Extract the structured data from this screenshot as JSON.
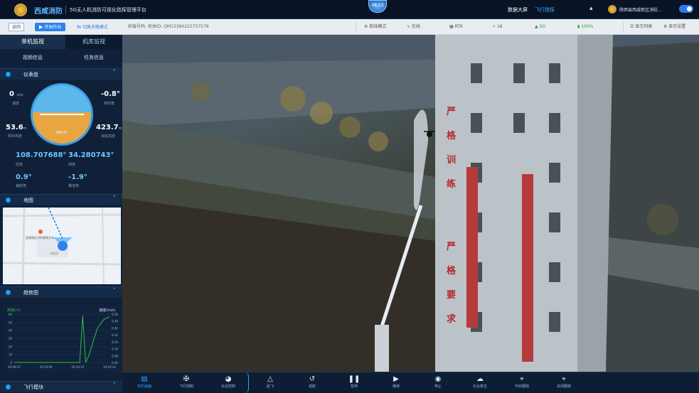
{
  "header": {
    "brand": "西咸消防",
    "subtitle": "5G无人机消防可视化指挥管理平台",
    "time": "08:13",
    "nav_dashboard": "数据大屏",
    "nav_flight": "飞行指挥",
    "user": "陕西省西咸新区消防...",
    "bell_icon": "bell-icon"
  },
  "toolbar": {
    "back": "返回",
    "play": "开始作业",
    "multi": "切换多路模式",
    "device": "机载号码: 机体ID: QM15384225757578",
    "mode": "航线模式",
    "signal": "在线",
    "rtk": "RTK",
    "satellites": "16",
    "net": "5G",
    "battery": "100%",
    "tasks": "显示列表",
    "settings": "显示设置"
  },
  "sidebar": {
    "tab_single": "单机监视",
    "tab_dock": "机库监视",
    "sub_video": "视频信息",
    "sub_task": "任务信息",
    "instrument": {
      "title": "仪表盘",
      "speed": "0",
      "speed_unit": "m/s",
      "speed_label": "速度",
      "pitch": "-0.8°",
      "pitch_label": "俯仰角",
      "alt_rel": "53.6",
      "alt_rel_unit": "m",
      "alt_rel_label": "相对高度",
      "alt_abs": "423.7",
      "alt_abs_unit": "m",
      "alt_abs_label": "海拔高度",
      "lon": "108.707688°",
      "lon_label": "经度",
      "lat": "34.280743°",
      "lat_label": "纬度",
      "heading": "0.9°",
      "heading_label": "偏航角",
      "roll": "-1.9°",
      "roll_label": "横滚角",
      "gauge_text": "HSI 0°"
    },
    "map": {
      "title": "地图",
      "poi": "西咸新区消防救援支队",
      "poi2": "训练塔"
    },
    "chart": {
      "title": "趋势图",
      "ylabel_left": "高度(m)",
      "ylabel_right": "速度(m/s)"
    },
    "flight": {
      "title": "飞行模块"
    }
  },
  "bottombar": [
    {
      "icon": "screen-icon",
      "label": "实时画面"
    },
    {
      "icon": "drone-icon",
      "label": "飞行控制"
    },
    {
      "icon": "gimbal-icon",
      "label": "云台控制"
    },
    {
      "icon": "takeoff-icon",
      "label": "起飞"
    },
    {
      "icon": "return-icon",
      "label": "返航"
    },
    {
      "icon": "pause-icon",
      "label": "暂停"
    },
    {
      "icon": "resume-icon",
      "label": "继续"
    },
    {
      "icon": "stop-icon",
      "label": "停止"
    },
    {
      "icon": "cloud-icon",
      "label": "云台复位"
    },
    {
      "icon": "target-icon",
      "label": "开启跟踪"
    },
    {
      "icon": "target-off-icon",
      "label": "关闭跟踪"
    }
  ],
  "scene": {
    "building_text_1": "严格训练",
    "building_text_2": "严格要求"
  },
  "chart_data": {
    "type": "line",
    "x": [
      "16:09:37",
      "16:10:00",
      "16:10:12",
      "16:10:24"
    ],
    "yticks_left": [
      0,
      10,
      20,
      30,
      40,
      50,
      60
    ],
    "yticks_right": [
      0,
      0.08,
      0.16,
      0.24,
      0.32,
      0.4,
      0.48,
      0.56
    ],
    "series": [
      {
        "color": "#2fbf3c",
        "values": [
          0,
          0,
          0,
          0,
          0,
          0,
          0,
          0,
          0,
          0,
          0,
          0,
          0,
          0,
          0,
          0,
          0,
          0,
          0,
          0,
          0,
          0,
          0,
          58,
          0,
          8,
          20,
          32,
          43,
          48,
          53,
          55,
          57
        ]
      }
    ]
  }
}
